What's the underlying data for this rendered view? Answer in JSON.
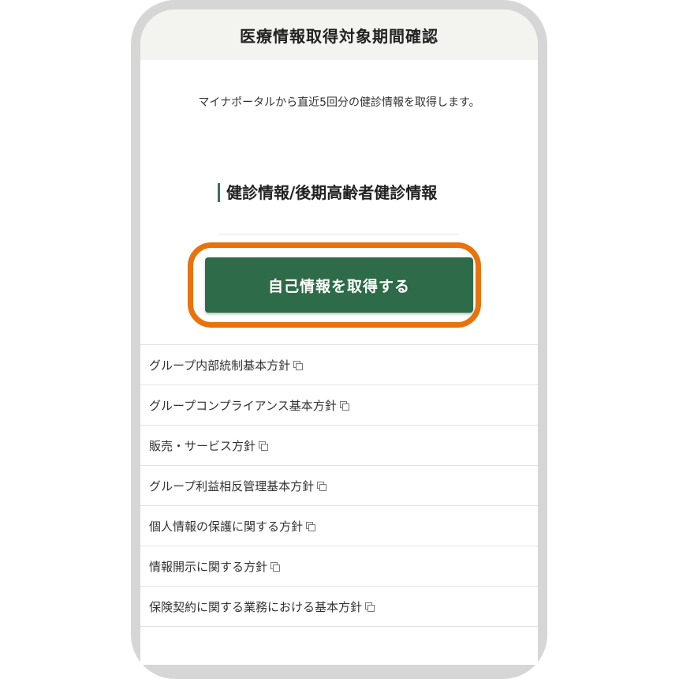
{
  "header": {
    "title": "医療情報取得対象期間確認"
  },
  "intro": {
    "text": "マイナポータルから直近5回分の健診情報を取得します。"
  },
  "section": {
    "heading": "健診情報/後期高齢者健診情報"
  },
  "button": {
    "label": "自己情報を取得する"
  },
  "links": [
    {
      "label": "グループ内部統制基本方針",
      "icon": "external-link-icon"
    },
    {
      "label": "グループコンプライアンス基本方針",
      "icon": "external-link-icon"
    },
    {
      "label": "販売・サービス方針",
      "icon": "external-link-icon"
    },
    {
      "label": "グループ利益相反管理基本方針",
      "icon": "external-link-icon"
    },
    {
      "label": "個人情報の保護に関する方針",
      "icon": "external-link-icon"
    },
    {
      "label": "情報開示に関する方針",
      "icon": "external-link-icon"
    },
    {
      "label": "保険契約に関する業務における基本方針",
      "icon": "external-link-icon"
    }
  ],
  "colors": {
    "accent_green": "#2e6b48",
    "highlight_orange": "#e8720c",
    "header_bg": "#f3f3ef"
  }
}
